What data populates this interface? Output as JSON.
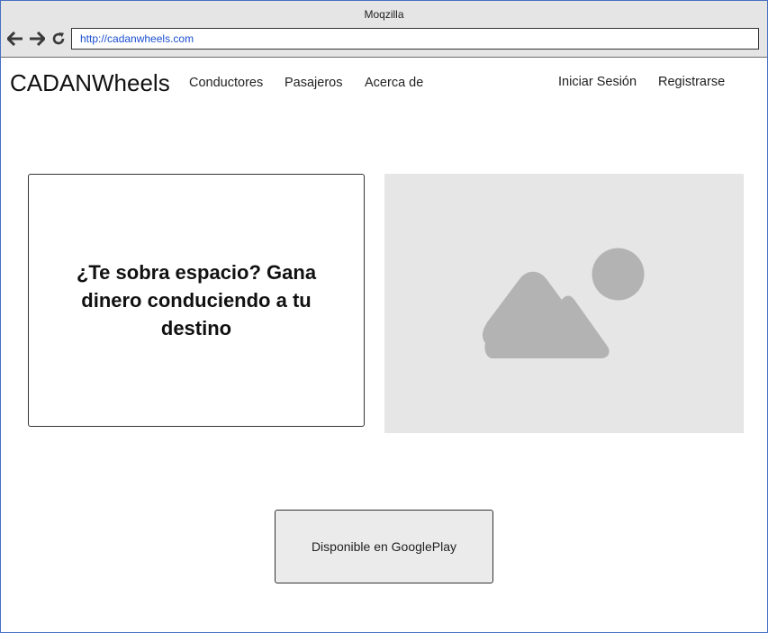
{
  "window": {
    "title": "Moqzilla",
    "url": "http://cadanwheels.com"
  },
  "icons": {
    "back": "arrow-left-icon",
    "forward": "arrow-right-icon",
    "reload": "reload-icon",
    "image": "image-placeholder-icon"
  },
  "colors": {
    "chrome_bg": "#e5e5e5",
    "url_text": "#1a4fd0",
    "placeholder_bg": "#e6e6e6",
    "placeholder_icon": "#b3b3b3",
    "button_bg": "#ebebeb"
  },
  "header": {
    "brand": "CADANWheels",
    "nav": {
      "drivers": "Conductores",
      "passengers": "Pasajeros",
      "about": "Acerca de",
      "login": "Iniciar Sesión",
      "register": "Registrarse"
    }
  },
  "hero": {
    "heading": "¿Te sobra espacio? Gana dinero conduciendo a tu destino"
  },
  "cta": {
    "label": "Disponible en GooglePlay"
  }
}
